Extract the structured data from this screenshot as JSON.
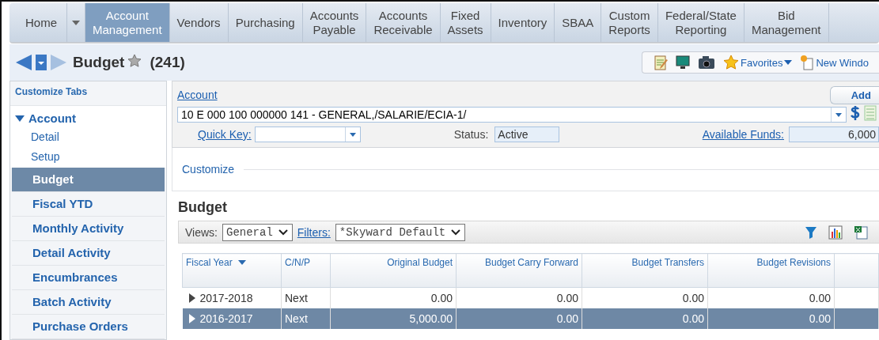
{
  "nav_tabs": [
    {
      "label": "Home",
      "selected": false
    },
    {
      "label": "Account Management",
      "selected": true
    },
    {
      "label": "Vendors",
      "selected": false
    },
    {
      "label": "Purchasing",
      "selected": false
    },
    {
      "label": "Accounts Payable",
      "selected": false
    },
    {
      "label": "Accounts Receivable",
      "selected": false
    },
    {
      "label": "Fixed Assets",
      "selected": false
    },
    {
      "label": "Inventory",
      "selected": false
    },
    {
      "label": "SBAA",
      "selected": false
    },
    {
      "label": "Custom Reports",
      "selected": false
    },
    {
      "label": "Federal/State Reporting",
      "selected": false
    },
    {
      "label": "Bid Management",
      "selected": false
    }
  ],
  "page": {
    "title": "Budget",
    "count": "(241)",
    "favorites": "Favorites",
    "new_window": "New Windo"
  },
  "sidebar": {
    "header": "Customize Tabs",
    "section": {
      "label": "Account",
      "expanded": true
    },
    "items": [
      {
        "label": "Detail",
        "kind": "sub",
        "selected": false
      },
      {
        "label": "Setup",
        "kind": "sub",
        "selected": false
      },
      {
        "label": "Budget",
        "kind": "tab",
        "selected": true
      },
      {
        "label": "Fiscal YTD",
        "kind": "tab",
        "selected": false
      },
      {
        "label": "Monthly Activity",
        "kind": "tab",
        "selected": false
      },
      {
        "label": "Detail Activity",
        "kind": "tab",
        "selected": false
      },
      {
        "label": "Encumbrances",
        "kind": "tab",
        "selected": false
      },
      {
        "label": "Batch Activity",
        "kind": "tab",
        "selected": false
      },
      {
        "label": "Purchase Orders",
        "kind": "tab",
        "selected": false
      }
    ]
  },
  "account": {
    "link": "Account",
    "add_button": "Add",
    "value": "10 E 000 100 000000 141 - GENERAL,/SALARIE/ECIA-1/",
    "quick_key_label": "Quick Key:",
    "status_label": "Status:",
    "status": "Active",
    "funds_label": "Available Funds:",
    "funds": "6,000",
    "customize": "Customize"
  },
  "grid": {
    "title": "Budget",
    "views_label": "Views:",
    "view": "General",
    "filters_label": "Filters:",
    "filter": "*Skyward Default",
    "columns": [
      "Fiscal Year",
      "C/N/P",
      "Original Budget",
      "Budget Carry Forward",
      "Budget Transfers",
      "Budget Revisions"
    ],
    "rows": [
      {
        "cells": [
          "2017-2018",
          "Next",
          "0.00",
          "0.00",
          "0.00",
          "0.00"
        ],
        "selected": false
      },
      {
        "cells": [
          "2016-2017",
          "Next",
          "5,000.00",
          "0.00",
          "0.00",
          "0.00"
        ],
        "selected": true
      }
    ]
  }
}
